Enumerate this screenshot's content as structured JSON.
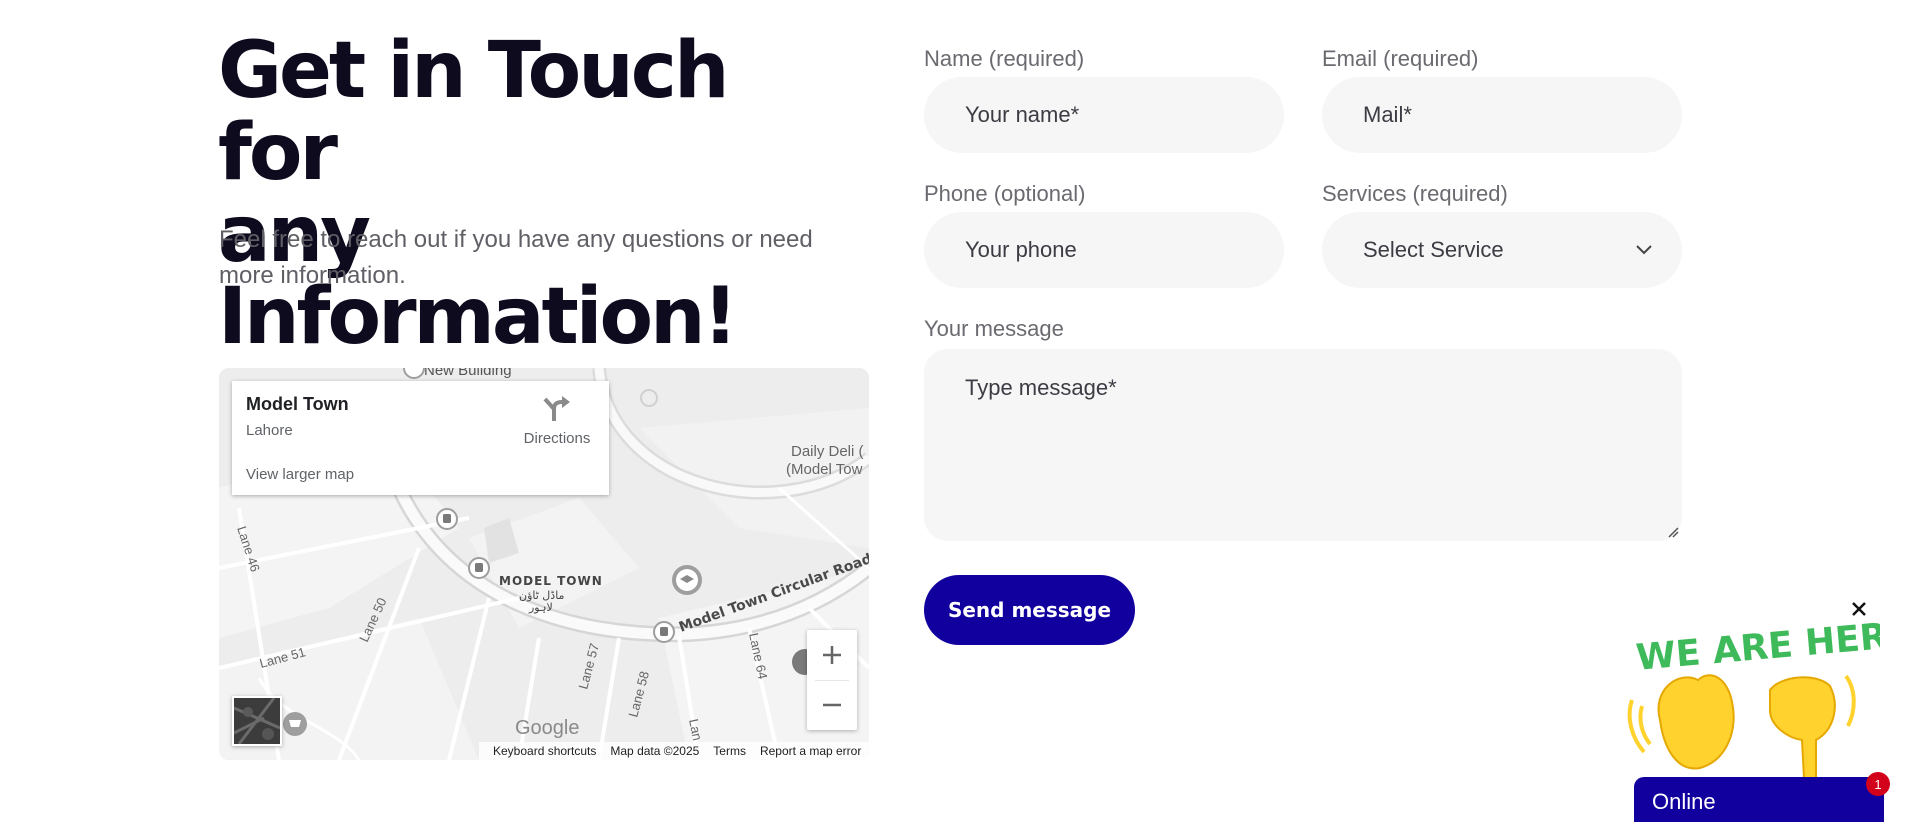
{
  "hero": {
    "title_line1": "Get in Touch for",
    "title_line2": "any Information!",
    "subtitle": "Feel free to reach out if you have any questions or need more information."
  },
  "map": {
    "place_name": "Model Town",
    "place_city": "Lahore",
    "directions_label": "Directions",
    "view_larger": "View larger map",
    "labels": {
      "new_building": "New Building",
      "daily_deli": "Daily Deli (",
      "daily_deli_2": "(Model Tow",
      "model_town": "MODEL TOWN",
      "model_town_urdu": "ماڈل ٹاؤن",
      "lahore_urdu": "لاہور",
      "circular_road": "Model Town Circular Road",
      "lane46": "Lane 46",
      "lane50": "Lane 50",
      "lane51": "Lane 51",
      "lane57": "Lane 57",
      "lane58": "Lane 58",
      "lane64": "Lane 64",
      "lane_left": "Lan"
    },
    "google": "Google",
    "attribution": {
      "shortcuts": "Keyboard shortcuts",
      "data": "Map data ©2025",
      "terms": "Terms",
      "report": "Report a map error"
    },
    "icons": [
      "directions-icon",
      "zoom-in-icon",
      "zoom-out-icon",
      "bus-stop-icon",
      "school-icon",
      "shopping-cart-icon"
    ]
  },
  "form": {
    "name_label": "Name (required)",
    "name_placeholder": "Your name*",
    "email_label": "Email (required)",
    "email_placeholder": "Mail*",
    "phone_label": "Phone (optional)",
    "phone_placeholder": "Your phone",
    "services_label": "Services (required)",
    "services_selected": "Select Service",
    "message_label": "Your message",
    "message_placeholder": "Type message*",
    "submit_label": "Send message"
  },
  "chat_widget": {
    "banner_text": "WE ARE HERE!",
    "status": "Online",
    "badge_count": "1"
  },
  "colors": {
    "accent": "#11009e",
    "banner_green": "#3fba5a",
    "badge_red": "#d3001b",
    "heading": "#0e0b1f",
    "field_bg": "#f6f6f6"
  }
}
